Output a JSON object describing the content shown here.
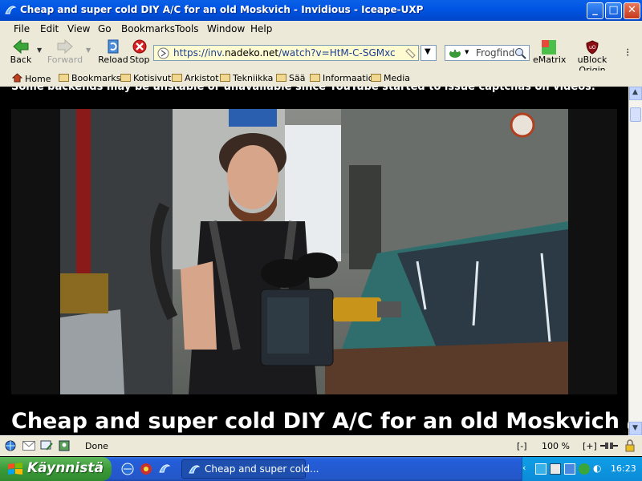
{
  "window": {
    "title": "Cheap and super cold DIY A/C for an old Moskvich - Invidious - Iceape-UXP",
    "buttons": {
      "minimize": "_",
      "maximize": "□",
      "close": "✕"
    }
  },
  "menubar": [
    "File",
    "Edit",
    "View",
    "Go",
    "Bookmarks",
    "Tools",
    "Window",
    "Help"
  ],
  "toolbar": {
    "back": "Back",
    "forward": "Forward",
    "reload": "Reload",
    "stop": "Stop",
    "url_prefix": "https://inv.",
    "url_host": "nadeko.net",
    "url_path": "/watch?v=HtM-C-SGMxc",
    "search_engine": "Frogfind",
    "ematrix": "eMatrix",
    "ublock": "uBlock Origin"
  },
  "bookmarks": [
    "Home",
    "Bookmarks",
    "Kotisivut",
    "Arkistot",
    "Tekniikka",
    "Sää",
    "Informaatio",
    "Media"
  ],
  "content": {
    "notice": "Some backends may be unstable or unavailable since YouTube started to issue captchas on videos.",
    "video_title": "Cheap and super cold DIY A/C for an old Moskvich",
    "video_title_icon": "headphones-icon"
  },
  "statusbar": {
    "status": "Done",
    "zoom_out": "[-]",
    "zoom": "100 %",
    "zoom_in": "[+]"
  },
  "taskbar": {
    "start": "Käynnistä",
    "task": "Cheap and super cold...",
    "clock": "16:23"
  },
  "colors": {
    "titlebar": "#0054e3",
    "chrome": "#ece9d8",
    "url_background": "#fffbd0",
    "start_button": "#3c9a3a",
    "tray": "#0c8bd8"
  }
}
